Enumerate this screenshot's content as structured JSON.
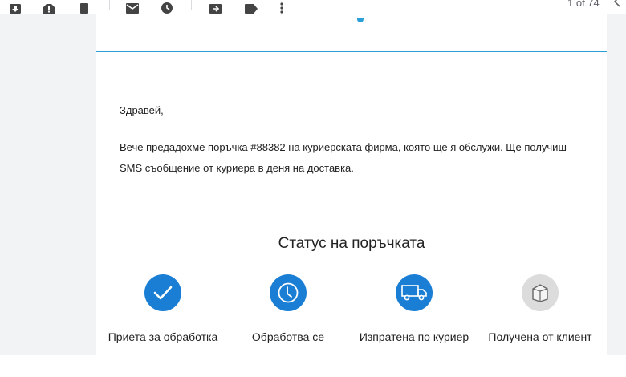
{
  "toolbar": {
    "items": [
      {
        "name": "archive-icon"
      },
      {
        "name": "report-spam-icon"
      },
      {
        "name": "delete-icon"
      },
      {
        "name": "mark-unread-icon"
      },
      {
        "name": "snooze-icon"
      },
      {
        "name": "move-to-icon"
      },
      {
        "name": "label-icon"
      },
      {
        "name": "more-options-icon"
      }
    ],
    "pager": "1 of 74"
  },
  "email": {
    "greeting": "Здравей,",
    "body": "Вече предадохме поръчка #88382 на куриерската фирма, която ще я обслужи. Ще получиш SMS съобщение от куриера в деня на доставка.",
    "status_title": "Статус на поръчката",
    "steps": [
      {
        "label": "Приета за обработка",
        "icon": "check-icon",
        "state": "done"
      },
      {
        "label": "Обработва се",
        "icon": "clock-icon",
        "state": "done"
      },
      {
        "label": "Изпратена по куриер",
        "icon": "truck-icon",
        "state": "done"
      },
      {
        "label": "Получена от клиент",
        "icon": "box-icon",
        "state": "pending"
      }
    ]
  },
  "colors": {
    "accent": "#2a9fd8",
    "step_active": "#1a7fd4",
    "step_pending": "#dcdcdc"
  }
}
